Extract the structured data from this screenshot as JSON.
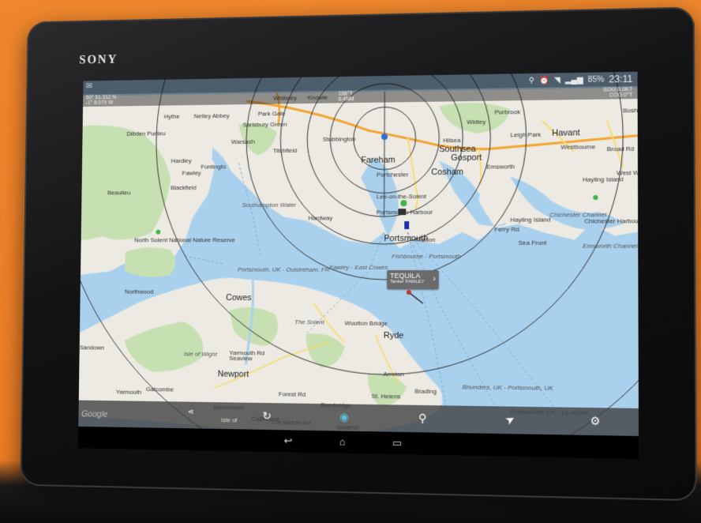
{
  "device": {
    "brand": "SONY"
  },
  "status_bar": {
    "time": "23:11",
    "battery": "85%"
  },
  "coordinates": {
    "lat": "50° 51.312 N",
    "lon": "-1° 8.079 W",
    "bearing": "158°T",
    "distance": "6.4NM",
    "sog": "SOG:0.0KT",
    "cog": "COG:0°T"
  },
  "map_labels": [
    {
      "text": "Whiteley",
      "cls": ""
    },
    {
      "text": "Knowle",
      "cls": ""
    },
    {
      "text": "Park Gate",
      "cls": ""
    },
    {
      "text": "Netley Abbey",
      "cls": ""
    },
    {
      "text": "Hythe",
      "cls": ""
    },
    {
      "text": "Dibden Purlieu",
      "cls": ""
    },
    {
      "text": "Hardley",
      "cls": ""
    },
    {
      "text": "Fawley",
      "cls": ""
    },
    {
      "text": "Blackfield",
      "cls": ""
    },
    {
      "text": "Beaulieu",
      "cls": ""
    },
    {
      "text": "North Solent National Nature Reserve",
      "cls": ""
    },
    {
      "text": "Sarisbury Green",
      "cls": ""
    },
    {
      "text": "Warsash",
      "cls": ""
    },
    {
      "text": "Titchfield",
      "cls": ""
    },
    {
      "text": "Stubbington",
      "cls": ""
    },
    {
      "text": "Fareham",
      "cls": "big"
    },
    {
      "text": "Portchester",
      "cls": ""
    },
    {
      "text": "Portsmouth Harbour",
      "cls": ""
    },
    {
      "text": "Hardway",
      "cls": ""
    },
    {
      "text": "Lee-on-the-Solent",
      "cls": ""
    },
    {
      "text": "Portsmouth",
      "cls": "big"
    },
    {
      "text": "Gosport",
      "cls": "big"
    },
    {
      "text": "Fratton",
      "cls": ""
    },
    {
      "text": "Southsea",
      "cls": "big"
    },
    {
      "text": "Cosham",
      "cls": "big"
    },
    {
      "text": "Hilsea",
      "cls": ""
    },
    {
      "text": "Widley",
      "cls": ""
    },
    {
      "text": "Purbrook",
      "cls": ""
    },
    {
      "text": "Leigh Park",
      "cls": ""
    },
    {
      "text": "Havant",
      "cls": "big"
    },
    {
      "text": "Westbourne",
      "cls": ""
    },
    {
      "text": "Emsworth",
      "cls": ""
    },
    {
      "text": "Hayling Island",
      "cls": ""
    },
    {
      "text": "Hayling Island",
      "cls": ""
    },
    {
      "text": "Chichester Harbour",
      "cls": ""
    },
    {
      "text": "Chichester Channel",
      "cls": "ital"
    },
    {
      "text": "Emsworth Channel",
      "cls": "ital"
    },
    {
      "text": "West Wittering",
      "cls": ""
    },
    {
      "text": "Bosha",
      "cls": ""
    },
    {
      "text": "Funtingto",
      "cls": ""
    },
    {
      "text": "Southampton Water",
      "cls": "ital"
    },
    {
      "text": "Fawley - East Cowes",
      "cls": "ital"
    },
    {
      "text": "Fishbourne - Portsmouth",
      "cls": "ital"
    },
    {
      "text": "Portsmouth, UK - Ouistreham, FR",
      "cls": "ital"
    },
    {
      "text": "Cowes",
      "cls": "big"
    },
    {
      "text": "Northwood",
      "cls": ""
    },
    {
      "text": "The Solent",
      "cls": "ital"
    },
    {
      "text": "Wootton Bridge",
      "cls": ""
    },
    {
      "text": "Ryde",
      "cls": "big"
    },
    {
      "text": "Seaview",
      "cls": ""
    },
    {
      "text": "Newport",
      "cls": "big"
    },
    {
      "text": "Isle of Wight",
      "cls": "ital"
    },
    {
      "text": "Yarmouth Rd",
      "cls": ""
    },
    {
      "text": "Forest Rd",
      "cls": ""
    },
    {
      "text": "Arreton",
      "cls": ""
    },
    {
      "text": "St. Helens",
      "cls": ""
    },
    {
      "text": "Brading",
      "cls": ""
    },
    {
      "text": "Bembridge",
      "cls": ""
    },
    {
      "text": "Godshill",
      "cls": ""
    },
    {
      "text": "Newchurch",
      "cls": ""
    },
    {
      "text": "Sandown",
      "cls": ""
    },
    {
      "text": "Gatcombe",
      "cls": ""
    },
    {
      "text": "Yarmouth",
      "cls": ""
    },
    {
      "text": "Calbourne",
      "cls": ""
    },
    {
      "text": "The Middle Rd",
      "cls": "ital"
    },
    {
      "text": "Portsmouth, UK - Le Havre",
      "cls": "ital"
    },
    {
      "text": "Bhunders, UK - Portsmouth, UK",
      "cls": "ital"
    },
    {
      "text": "Broad Rd",
      "cls": ""
    },
    {
      "text": "Ferry Rd",
      "cls": ""
    },
    {
      "text": "Sea Front",
      "cls": ""
    }
  ],
  "ship_popup": {
    "name": "TEQUILA",
    "detail": "Tanker FAWLEY",
    "chevron": "›"
  },
  "toolbar": {
    "google": "Google",
    "isle_label": "Isle of",
    "refresh": "↻",
    "search": "⚲",
    "navigate": "➤",
    "settings": "⚙"
  },
  "nav_bar": {
    "back": "↩",
    "home": "⌂",
    "recents": "▭"
  },
  "colors": {
    "water": "#a9d1ee",
    "land": "#eceae3",
    "green": "#c7e0b2",
    "orange_road": "#f3a531",
    "yellow_road": "#f7dd6f"
  }
}
